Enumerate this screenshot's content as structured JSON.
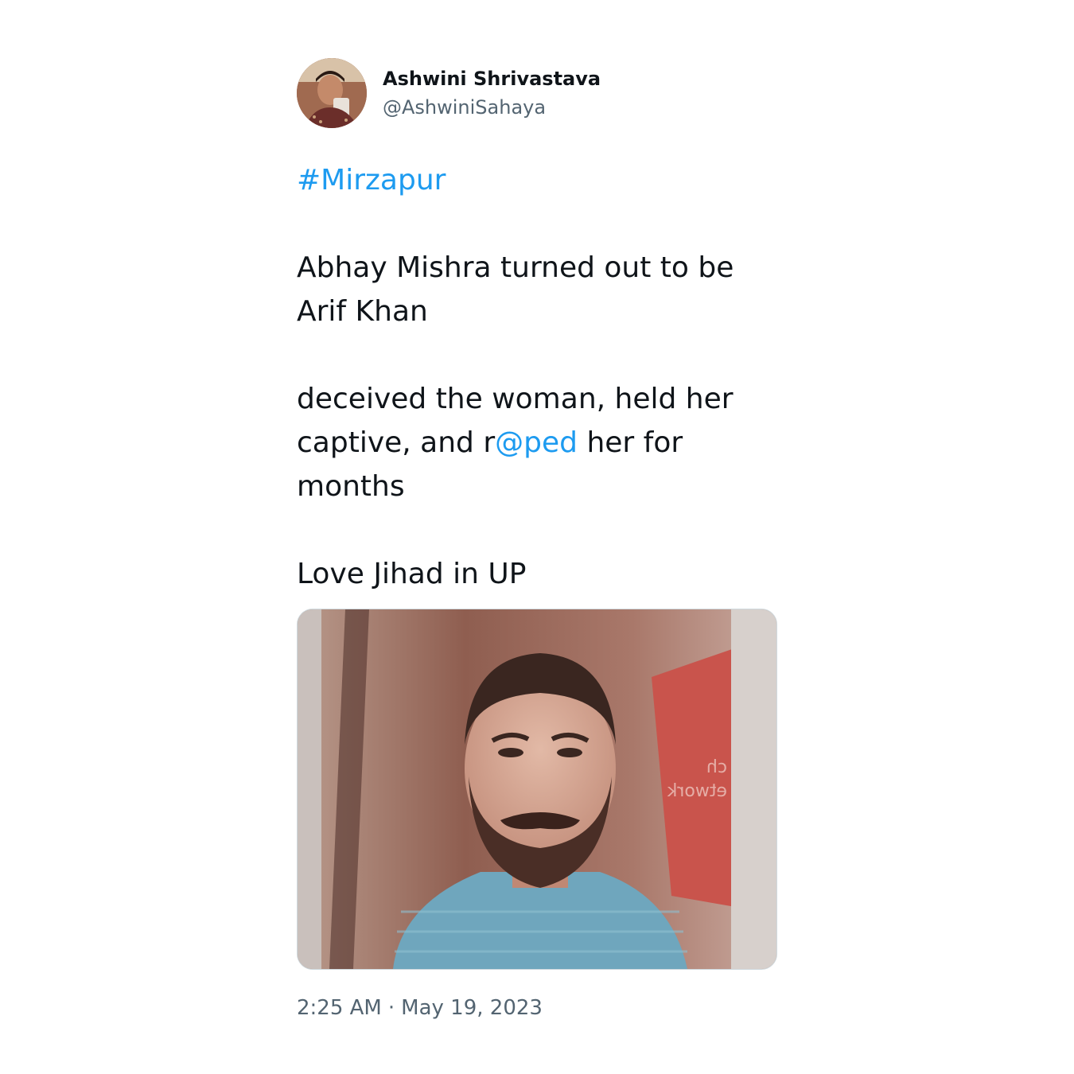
{
  "author": {
    "display_name": "Ashwini Shrivastava",
    "handle": "@AshwiniSahaya",
    "avatar_icon": "user-avatar-photo"
  },
  "tweet": {
    "hashtag": "#Mirzapur",
    "line1": "Abhay Mishra turned out to be",
    "line2": "Arif Khan",
    "line3": "deceived the woman, held her",
    "line4_pre": "captive, and r",
    "line4_link": "@ped",
    "line4_post": " her for",
    "line5": "months",
    "line6": "Love Jihad in UP"
  },
  "media": {
    "image_icon": "attached-photo",
    "sign_text_1": "ch",
    "sign_text_2": "etwork"
  },
  "meta": {
    "time": "2:25 AM",
    "separator": "·",
    "date": "May 19, 2023"
  },
  "colors": {
    "link": "#1d9bf0",
    "text": "#0f1419",
    "secondary": "#536471",
    "border": "#cfd9de"
  }
}
